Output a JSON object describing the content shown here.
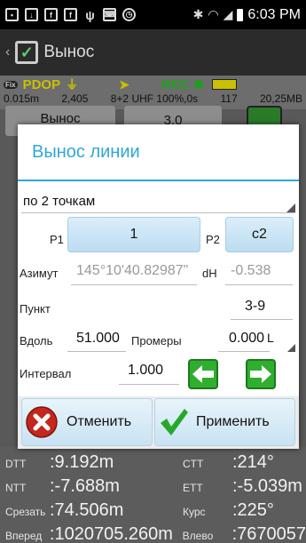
{
  "status": {
    "time": "6:03 PM",
    "icons": [
      "message-icon",
      "download-icon",
      "facebook-icon",
      "facebook-icon",
      "usb-icon",
      "keyboard-icon",
      "alarm-icon",
      "bluetooth-icon",
      "wifi-icon",
      "signal-icon",
      "battery-icon"
    ]
  },
  "app": {
    "title": "Вынос",
    "fix_label": "Fix",
    "pdop_label": "PDOP",
    "rec_label": "REC",
    "info": {
      "accuracy": "0.015m",
      "age": "2,405",
      "sats": "8+2 UHF 100%,0s",
      "count": "117",
      "storage": "20,25MB"
    },
    "bg_button": "Вынос",
    "bg_field": "3.0"
  },
  "dialog": {
    "title": "Вынос линии",
    "mode": "по 2 точкам",
    "p1_label": "P1",
    "p1_value": "1",
    "p2_label": "P2",
    "p2_value": "c2",
    "azimuth_label": "Азимут",
    "azimuth_value": "145°10'40.82987\"",
    "dh_label": "dH",
    "dh_value": "-0.538",
    "point_label": "Пункт",
    "point_value": "3-9",
    "along_label": "Вдоль",
    "along_value": "51.000",
    "measures_label": "Промеры",
    "measures_value": "0.000",
    "side_value": "L",
    "interval_label": "Интервал",
    "interval_value": "1.000",
    "cancel_label": "Отменить",
    "apply_label": "Применить"
  },
  "bottom": {
    "rows": [
      {
        "l1": "DTT",
        "v1": ":9.192m",
        "l2": "CTT",
        "v2": ":214°"
      },
      {
        "l1": "NTT",
        "v1": ":-7.688m",
        "l2": "ETT",
        "v2": ":-5.039m"
      },
      {
        "l1": "Срезать",
        "v1": ":74.506m",
        "l2": "Курс",
        "v2": ":225°"
      },
      {
        "l1": "Вперед",
        "v1": ":1020705.260m",
        "l2": "Влево",
        "v2": ":7670057"
      }
    ]
  }
}
